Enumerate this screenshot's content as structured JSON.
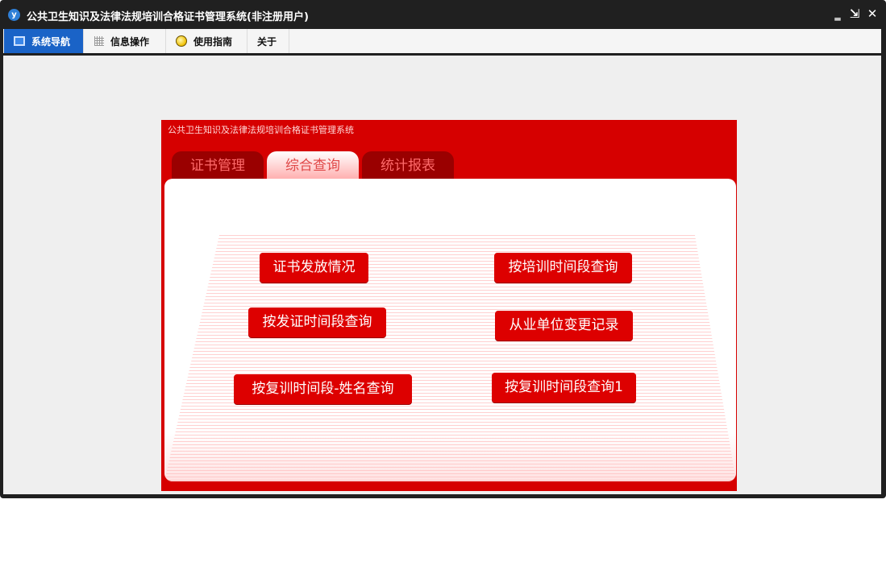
{
  "window": {
    "title": "公共卫生知识及法律法规培训合格证书管理系统(非注册用户)",
    "app_icon": "y",
    "controls": {
      "minimize": "‗",
      "restore": "⇲",
      "close": "✕"
    }
  },
  "menu": {
    "items": [
      {
        "label": "系统导航",
        "icon": "monitor-icon",
        "active": true
      },
      {
        "label": "信息操作",
        "icon": "grid-icon",
        "active": false
      },
      {
        "label": "使用指南",
        "icon": "lightbulb-icon",
        "active": false
      },
      {
        "label": "关于",
        "icon": "",
        "active": false
      }
    ]
  },
  "panel": {
    "title": "公共卫生知识及法律法规培训合格证书管理系统",
    "tabs": [
      {
        "label": "证书管理",
        "selected": false
      },
      {
        "label": "综合查询",
        "selected": true
      },
      {
        "label": "统计报表",
        "selected": false
      }
    ],
    "buttons": [
      {
        "label": "证书发放情况"
      },
      {
        "label": "按培训时间段查询"
      },
      {
        "label": "按发证时间段查询"
      },
      {
        "label": "从业单位变更记录"
      },
      {
        "label": "按复训时间段-姓名查询"
      },
      {
        "label": "按复训时间段查询1"
      }
    ]
  },
  "colors": {
    "window_frame": "#202020",
    "menu_active": "#1a63c7",
    "panel_red": "#d60000",
    "tab_dark": "#9a0000",
    "button_red": "#dd0000"
  }
}
